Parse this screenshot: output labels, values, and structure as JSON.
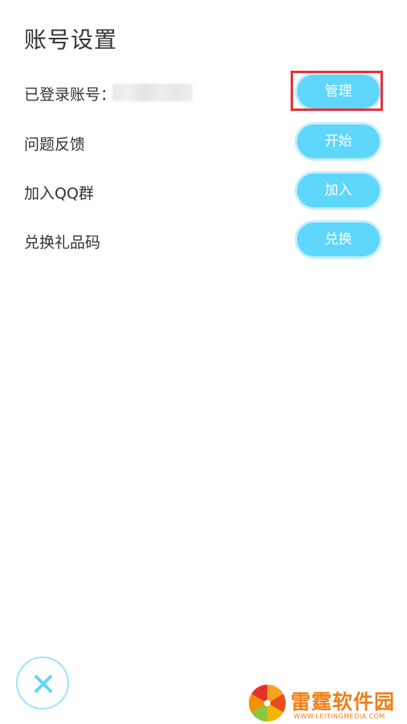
{
  "header": {
    "title": "账号设置"
  },
  "rows": [
    {
      "label": "已登录账号：",
      "button": "管理"
    },
    {
      "label": "问题反馈",
      "button": "开始"
    },
    {
      "label": "加入QQ群",
      "button": "加入"
    },
    {
      "label": "兑换礼品码",
      "button": "兑换"
    }
  ],
  "colors": {
    "button_bg": "#5fd6fb",
    "highlight": "#e8313a",
    "watermark": "#f07f1a"
  },
  "icons": {
    "close": "close-icon",
    "watermark_logo": "orange-slice-logo"
  },
  "watermark": {
    "name": "雷霆软件园",
    "url": "WWW.LEITINGMEDIA.COM"
  }
}
